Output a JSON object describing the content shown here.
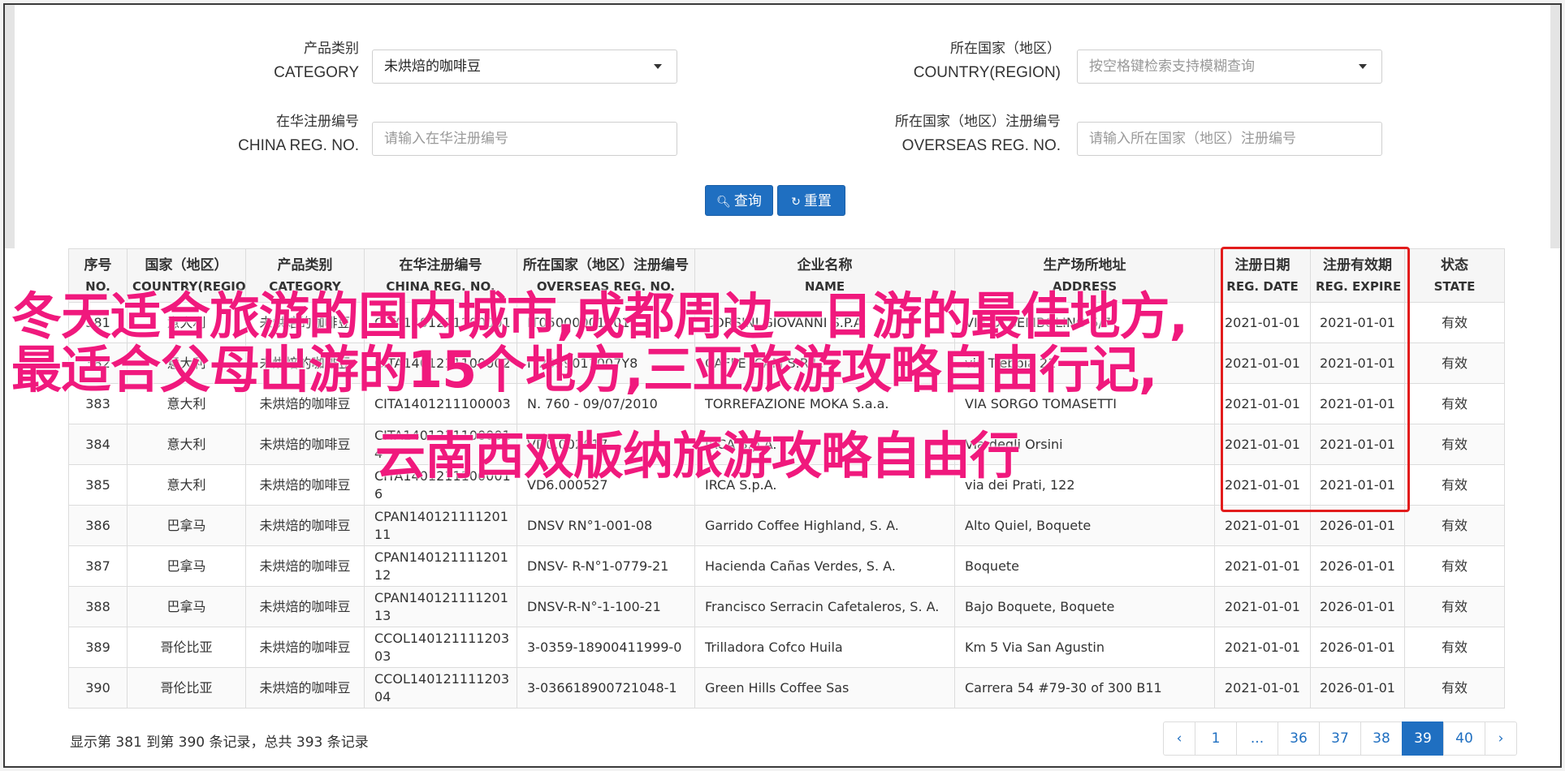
{
  "filters": {
    "category_zh": "产品类别",
    "category_en": "CATEGORY",
    "category_value": "未烘焙的咖啡豆",
    "country_zh": "所在国家（地区）",
    "country_en": "COUNTRY(REGION)",
    "country_placeholder": "按空格键检索支持模糊查询",
    "china_reg_zh": "在华注册编号",
    "china_reg_en": "CHINA REG. NO.",
    "china_reg_placeholder": "请输入在华注册编号",
    "overseas_reg_zh": "所在国家（地区）注册编号",
    "overseas_reg_en": "OVERSEAS REG. NO.",
    "overseas_reg_placeholder": "请输入所在国家（地区）注册编号",
    "search_label": "查询",
    "reset_label": "重置"
  },
  "table": {
    "headers": [
      {
        "zh": "序号",
        "en": "NO."
      },
      {
        "zh": "国家（地区）",
        "en": "COUNTRY(REGIO..."
      },
      {
        "zh": "产品类别",
        "en": "CATEGORY"
      },
      {
        "zh": "在华注册编号",
        "en": "CHINA REG. NO."
      },
      {
        "zh": "所在国家（地区）注册编号",
        "en": "OVERSEAS REG. NO."
      },
      {
        "zh": "企业名称",
        "en": "NAME"
      },
      {
        "zh": "生产场所地址",
        "en": "ADDRESS"
      },
      {
        "zh": "注册日期",
        "en": "REG. DATE"
      },
      {
        "zh": "注册有效期",
        "en": "REG. EXPIRE ..."
      },
      {
        "zh": "状态",
        "en": "STATE"
      }
    ],
    "rows": [
      {
        "no": "381",
        "country": "意大利",
        "category": "未烘焙的咖啡豆",
        "china_reg": "CITA1401211100001",
        "overseas_reg": "IT05000001001",
        "name": "CORSINI GIOVANNI S.P.A.",
        "address": "VIA DI SEMBOLINO 5/7",
        "reg_date": "2021-01-01",
        "expire": "2021-01-01",
        "state": "有效"
      },
      {
        "no": "382",
        "country": "意大利",
        "category": "未烘焙的咖啡豆",
        "china_reg": "CITA1401211100002",
        "overseas_reg": "IT2059011007Y8",
        "name": "CAFFE ICAM S.R.L.",
        "address": "via Trebbia 21",
        "reg_date": "2021-01-01",
        "expire": "2021-01-01",
        "state": "有效"
      },
      {
        "no": "383",
        "country": "意大利",
        "category": "未烘焙的咖啡豆",
        "china_reg": "CITA1401211100003",
        "overseas_reg": "N. 760 - 09/07/2010",
        "name": "TORREFAZIONE MOKA S.a.a.",
        "address": "VIA SORGO TOMASETTI",
        "reg_date": "2021-01-01",
        "expire": "2021-01-01",
        "state": "有效"
      },
      {
        "no": "384",
        "country": "意大利",
        "category": "未烘焙的咖啡豆",
        "china_reg": "CITA14012111000014",
        "overseas_reg": "VD0.002617",
        "name": "IRCA S.p.A.",
        "address": "Via degli Orsini",
        "reg_date": "2021-01-01",
        "expire": "2021-01-01",
        "state": "有效"
      },
      {
        "no": "385",
        "country": "意大利",
        "category": "未烘焙的咖啡豆",
        "china_reg": "CITA14012111000016",
        "overseas_reg": "VD6.000527",
        "name": "IRCA S.p.A.",
        "address": "via dei Prati, 122",
        "reg_date": "2021-01-01",
        "expire": "2021-01-01",
        "state": "有效"
      },
      {
        "no": "386",
        "country": "巴拿马",
        "category": "未烘焙的咖啡豆",
        "china_reg": "CPAN14012111120111",
        "overseas_reg": "DNSV RN°1-001-08",
        "name": "Garrido Coffee Highland, S. A.",
        "address": "Alto Quiel, Boquete",
        "reg_date": "2021-01-01",
        "expire": "2026-01-01",
        "state": "有效"
      },
      {
        "no": "387",
        "country": "巴拿马",
        "category": "未烘焙的咖啡豆",
        "china_reg": "CPAN14012111120112",
        "overseas_reg": "DNSV- R-N°1-0779-21",
        "name": "Hacienda Cañas Verdes, S. A.",
        "address": "Boquete",
        "reg_date": "2021-01-01",
        "expire": "2026-01-01",
        "state": "有效"
      },
      {
        "no": "388",
        "country": "巴拿马",
        "category": "未烘焙的咖啡豆",
        "china_reg": "CPAN14012111120113",
        "overseas_reg": "DNSV-R-N°-1-100-21",
        "name": "Francisco Serracin Cafetaleros, S. A.",
        "address": "Bajo Boquete, Boquete",
        "reg_date": "2021-01-01",
        "expire": "2026-01-01",
        "state": "有效"
      },
      {
        "no": "389",
        "country": "哥伦比亚",
        "category": "未烘焙的咖啡豆",
        "china_reg": "CCOL14012111120303",
        "overseas_reg": "3-0359-18900411999-0",
        "name": "Trilladora Cofco Huila",
        "address": "Km 5 Via San Agustin",
        "reg_date": "2021-01-01",
        "expire": "2026-01-01",
        "state": "有效"
      },
      {
        "no": "390",
        "country": "哥伦比亚",
        "category": "未烘焙的咖啡豆",
        "china_reg": "CCOL14012111120304",
        "overseas_reg": "3-036618900721048-1",
        "name": "Green Hills Coffee Sas",
        "address": "Carrera 54 #79-30 of 300 B11",
        "reg_date": "2021-01-01",
        "expire": "2026-01-01",
        "state": "有效"
      }
    ]
  },
  "overlay": {
    "line1": "冬天适合旅游的国内城市,成都周边一日游的最佳地方,",
    "line2": "最适合父母出游的15个地方,三亚旅游攻略自由行记,",
    "line3": "云南西双版纳旅游攻略自由行"
  },
  "footer": {
    "info": "显示第 381 到第 390 条记录，总共 393 条记录"
  },
  "pagination": {
    "prev": "‹",
    "pages": [
      "1",
      "...",
      "36",
      "37",
      "38",
      "39",
      "40"
    ],
    "active": "39",
    "next": "›"
  },
  "colors": {
    "primary": "#1f6fc1",
    "highlight_box": "#e21c1c",
    "overlay_text": "#f0197d"
  }
}
